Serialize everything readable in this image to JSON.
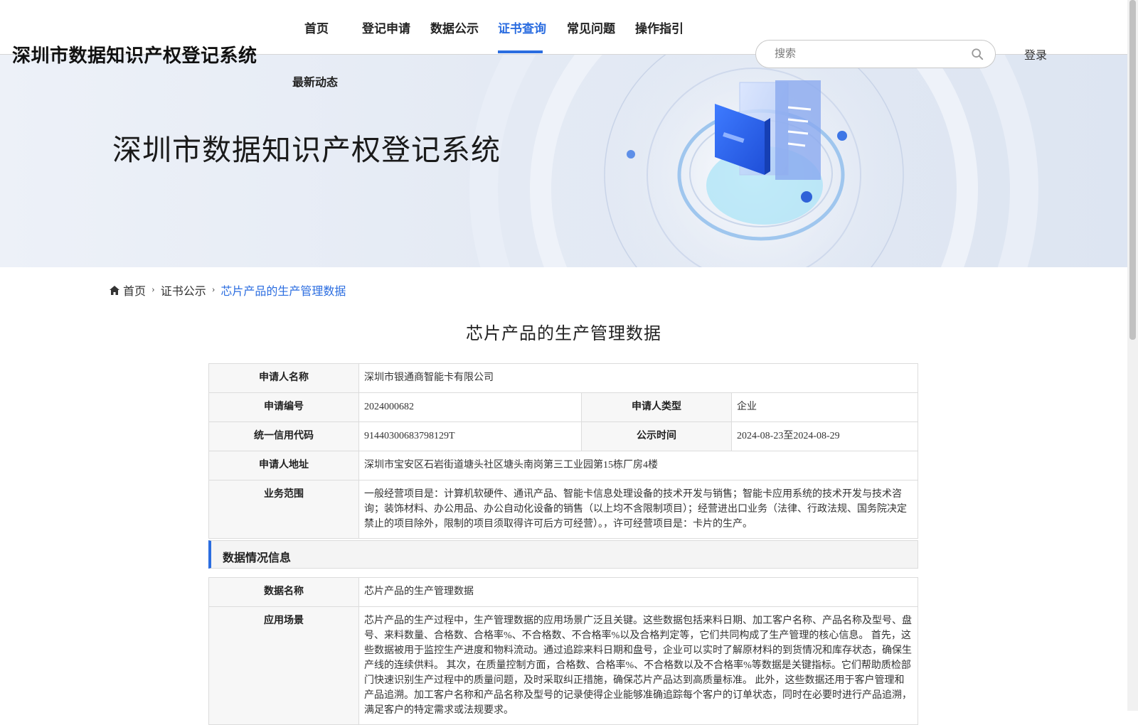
{
  "header": {
    "site_title": "深圳市数据知识产权登记系统",
    "nav": [
      "首页",
      "登记申请",
      "数据公示",
      "证书查询",
      "常见问题",
      "操作指引"
    ],
    "nav_second": "最新动态",
    "active_nav": "证书查询",
    "search_placeholder": "搜索",
    "login": "登录"
  },
  "banner": {
    "title": "深圳市数据知识产权登记系统"
  },
  "breadcrumb": {
    "home": "首页",
    "level2": "证书公示",
    "current": "芯片产品的生产管理数据"
  },
  "page_title": "芯片产品的生产管理数据",
  "applicant": {
    "name_label": "申请人名称",
    "name": "深圳市银通商智能卡有限公司",
    "number_label": "申请编号",
    "number": "2024000682",
    "type_label": "申请人类型",
    "type": "企业",
    "credit_code_label": "统一信用代码",
    "credit_code": "91440300683798129T",
    "publicity_label": "公示时间",
    "publicity": "2024-08-23至2024-08-29",
    "address_label": "申请人地址",
    "address": "深圳市宝安区石岩街道塘头社区塘头南岗第三工业园第15栋厂房4楼",
    "scope_label": "业务范围",
    "scope": "一般经营项目是：计算机软硬件、通讯产品、智能卡信息处理设备的技术开发与销售；智能卡应用系统的技术开发与技术咨询；装饰材料、办公用品、办公自动化设备的销售（以上均不含限制项目）；经营进出口业务（法律、行政法规、国务院决定禁止的项目除外，限制的项目须取得许可后方可经营）。，许可经营项目是：卡片的生产。"
  },
  "data_section": {
    "title": "数据情况信息",
    "data_name_label": "数据名称",
    "data_name": "芯片产品的生产管理数据",
    "scenario_label": "应用场景",
    "scenario": "芯片产品的生产过程中，生产管理数据的应用场景广泛且关键。这些数据包括来料日期、加工客户名称、产品名称及型号、盘号、来料数量、合格数、合格率%、不合格数、不合格率%以及合格判定等，它们共同构成了生产管理的核心信息。 首先，这些数据被用于监控生产进度和物料流动。通过追踪来料日期和盘号，企业可以实时了解原材料的到货情况和库存状态，确保生产线的连续供料。 其次，在质量控制方面，合格数、合格率%、不合格数以及不合格率%等数据是关键指标。它们帮助质检部门快速识别生产过程中的质量问题，及时采取纠正措施，确保芯片产品达到高质量标准。 此外，这些数据还用于客户管理和产品追溯。加工客户名称和产品名称及型号的记录使得企业能够准确追踪每个客户的订单状态，同时在必要时进行产品追溯，满足客户的特定需求或法规要求。"
  },
  "colors": {
    "accent": "#2b6de0"
  }
}
